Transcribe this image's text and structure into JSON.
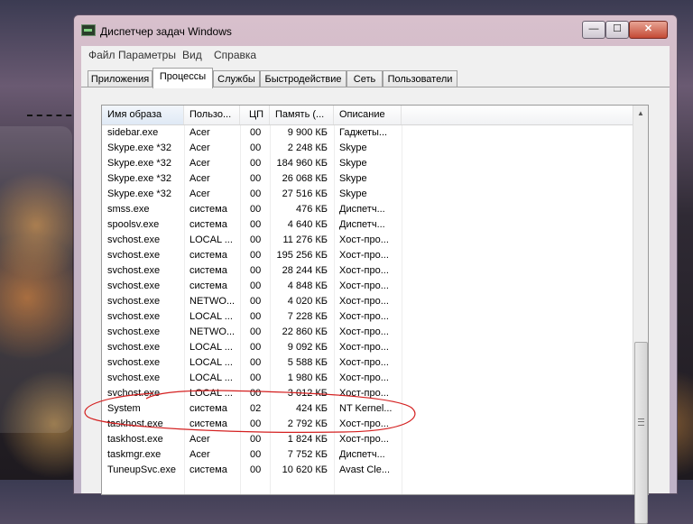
{
  "window": {
    "title": "Диспетчер задач Windows",
    "min_glyph": "—",
    "max_glyph": "☐",
    "close_glyph": "✕"
  },
  "menu": [
    "Файл",
    "Параметры",
    "Вид",
    "Справка"
  ],
  "tabs": [
    "Приложения",
    "Процессы",
    "Службы",
    "Быстродействие",
    "Сеть",
    "Пользователи"
  ],
  "active_tab": "Процессы",
  "columns": [
    "Имя образа",
    "Пользо...",
    "ЦП",
    "Память (...",
    "Описание"
  ],
  "sorted_column": "Имя образа",
  "processes": [
    {
      "name": "sidebar.exe",
      "user": "Acer",
      "cpu": "00",
      "mem": "9 900 КБ",
      "desc": "Гаджеты..."
    },
    {
      "name": "Skype.exe *32",
      "user": "Acer",
      "cpu": "00",
      "mem": "2 248 КБ",
      "desc": "Skype"
    },
    {
      "name": "Skype.exe *32",
      "user": "Acer",
      "cpu": "00",
      "mem": "184 960 КБ",
      "desc": "Skype"
    },
    {
      "name": "Skype.exe *32",
      "user": "Acer",
      "cpu": "00",
      "mem": "26 068 КБ",
      "desc": "Skype"
    },
    {
      "name": "Skype.exe *32",
      "user": "Acer",
      "cpu": "00",
      "mem": "27 516 КБ",
      "desc": "Skype"
    },
    {
      "name": "smss.exe",
      "user": "система",
      "cpu": "00",
      "mem": "476 КБ",
      "desc": "Диспетч..."
    },
    {
      "name": "spoolsv.exe",
      "user": "система",
      "cpu": "00",
      "mem": "4 640 КБ",
      "desc": "Диспетч..."
    },
    {
      "name": "svchost.exe",
      "user": "LOCAL ...",
      "cpu": "00",
      "mem": "11 276 КБ",
      "desc": "Хост-про..."
    },
    {
      "name": "svchost.exe",
      "user": "система",
      "cpu": "00",
      "mem": "195 256 КБ",
      "desc": "Хост-про..."
    },
    {
      "name": "svchost.exe",
      "user": "система",
      "cpu": "00",
      "mem": "28 244 КБ",
      "desc": "Хост-про..."
    },
    {
      "name": "svchost.exe",
      "user": "система",
      "cpu": "00",
      "mem": "4 848 КБ",
      "desc": "Хост-про..."
    },
    {
      "name": "svchost.exe",
      "user": "NETWO...",
      "cpu": "00",
      "mem": "4 020 КБ",
      "desc": "Хост-про..."
    },
    {
      "name": "svchost.exe",
      "user": "LOCAL ...",
      "cpu": "00",
      "mem": "7 228 КБ",
      "desc": "Хост-про..."
    },
    {
      "name": "svchost.exe",
      "user": "NETWO...",
      "cpu": "00",
      "mem": "22 860 КБ",
      "desc": "Хост-про..."
    },
    {
      "name": "svchost.exe",
      "user": "LOCAL ...",
      "cpu": "00",
      "mem": "9 092 КБ",
      "desc": "Хост-про..."
    },
    {
      "name": "svchost.exe",
      "user": "LOCAL ...",
      "cpu": "00",
      "mem": "5 588 КБ",
      "desc": "Хост-про..."
    },
    {
      "name": "svchost.exe",
      "user": "LOCAL ...",
      "cpu": "00",
      "mem": "1 980 КБ",
      "desc": "Хост-про..."
    },
    {
      "name": "svchost.exe",
      "user": "LOCAL ...",
      "cpu": "00",
      "mem": "3 012 КБ",
      "desc": "Хост-про..."
    },
    {
      "name": "System",
      "user": "система",
      "cpu": "02",
      "mem": "424 КБ",
      "desc": "NT Kernel..."
    },
    {
      "name": "taskhost.exe",
      "user": "система",
      "cpu": "00",
      "mem": "2 792 КБ",
      "desc": "Хост-про..."
    },
    {
      "name": "taskhost.exe",
      "user": "Acer",
      "cpu": "00",
      "mem": "1 824 КБ",
      "desc": "Хост-про..."
    },
    {
      "name": "taskmgr.exe",
      "user": "Acer",
      "cpu": "00",
      "mem": "7 752 КБ",
      "desc": "Диспетч..."
    },
    {
      "name": "TuneupSvc.exe",
      "user": "система",
      "cpu": "00",
      "mem": "10 620 КБ",
      "desc": "Avast Cle..."
    }
  ],
  "highlighted_process": "System",
  "annotation_color": "#d42020",
  "icons": {
    "app": "task-manager-icon",
    "scroll_up": "scroll-up-arrow-icon"
  }
}
